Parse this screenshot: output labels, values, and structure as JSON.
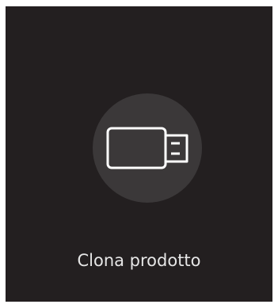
{
  "tile": {
    "icon": "usb-drive-icon",
    "label": "Clona prodotto",
    "colors": {
      "background": "#231f20",
      "circle": "#3b3839",
      "icon_stroke": "#ffffff",
      "label": "#e6e6e6"
    }
  }
}
